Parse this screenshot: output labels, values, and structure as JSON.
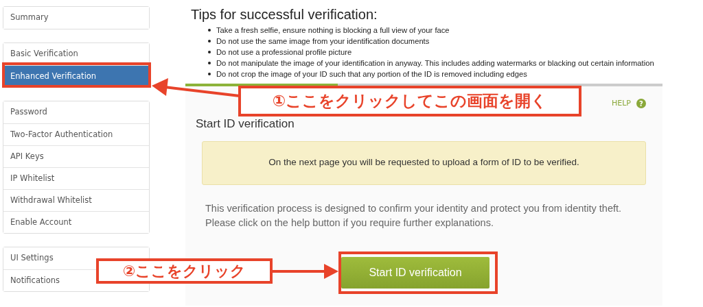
{
  "sidebar": {
    "groups": [
      {
        "items": [
          {
            "label": "Summary",
            "selected": false
          }
        ]
      },
      {
        "items": [
          {
            "label": "Basic Verification",
            "selected": false
          },
          {
            "label": "Enhanced Verification",
            "selected": true
          }
        ]
      },
      {
        "items": [
          {
            "label": "Password",
            "selected": false
          },
          {
            "label": "Two-Factor Authentication",
            "selected": false
          },
          {
            "label": "API Keys",
            "selected": false
          },
          {
            "label": "IP Whitelist",
            "selected": false
          },
          {
            "label": "Withdrawal Whitelist",
            "selected": false
          },
          {
            "label": "Enable Account",
            "selected": false
          }
        ]
      },
      {
        "items": [
          {
            "label": "UI Settings",
            "selected": false
          },
          {
            "label": "Notifications",
            "selected": false
          }
        ]
      }
    ]
  },
  "tips": {
    "title": "Tips for successful verification:",
    "items": [
      "Take a fresh selfie, ensure nothing is blocking a full view of your face",
      "Do not use the same image from your identification documents",
      "Do not use a professional profile picture",
      "Do not manipulate the image of your identification in anyway. This includes adding watermarks or blacking out certain information",
      "Do not crop the image of your ID such that any portion of the ID is removed including edges"
    ]
  },
  "progress": {
    "level": 0.32
  },
  "panel": {
    "help": "HELP",
    "help_icon": "?",
    "title": "Start ID verification",
    "notice": "On the next page you will be requested to upload a form of ID to be verified.",
    "description": "This verification process is designed to confirm your identity and protect you from identity theft. Please click on the help button if you require further explanations.",
    "button": "Start ID verification"
  },
  "annotations": [
    {
      "text": "①ここをクリックしてこの画面を開く"
    },
    {
      "text": "②ここをクリック"
    }
  ]
}
